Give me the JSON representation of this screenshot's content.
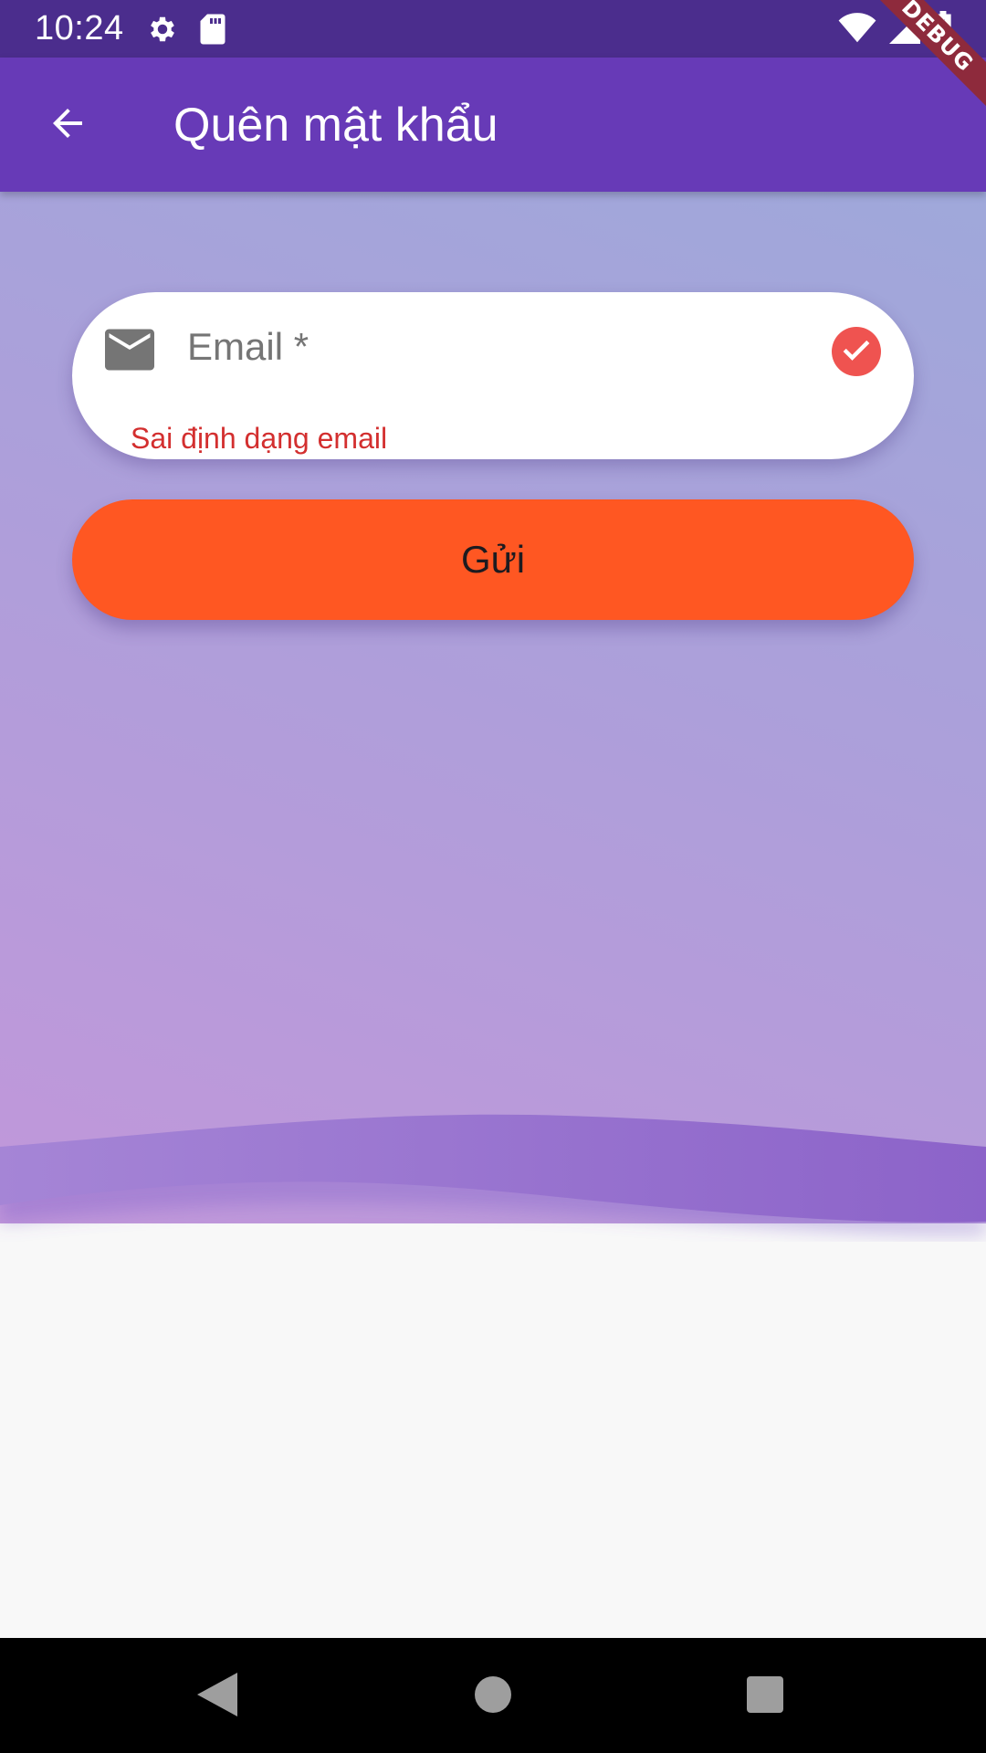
{
  "status_bar": {
    "time": "10:24",
    "left_icons": [
      "gear-icon",
      "sd-card-icon"
    ],
    "right_icons": [
      "wifi-icon",
      "cell-signal-icon",
      "battery-charging-icon"
    ]
  },
  "debug_banner": "DEBUG",
  "app_bar": {
    "title": "Quên mật khẩu",
    "back_icon": "arrow-back-icon",
    "color": "#673ab7"
  },
  "email_field": {
    "label": "Email *",
    "value": "",
    "error": "Sai định dạng email",
    "leading_icon": "mail-icon",
    "trailing_icon": "check-circle-icon",
    "check_color": "#ef5350",
    "error_color": "#d32f2f"
  },
  "send_button": {
    "label": "Gửi",
    "color": "#ff5722"
  },
  "nav_bar": {
    "buttons": [
      "back-triangle-icon",
      "home-circle-icon",
      "recents-square-icon"
    ]
  }
}
